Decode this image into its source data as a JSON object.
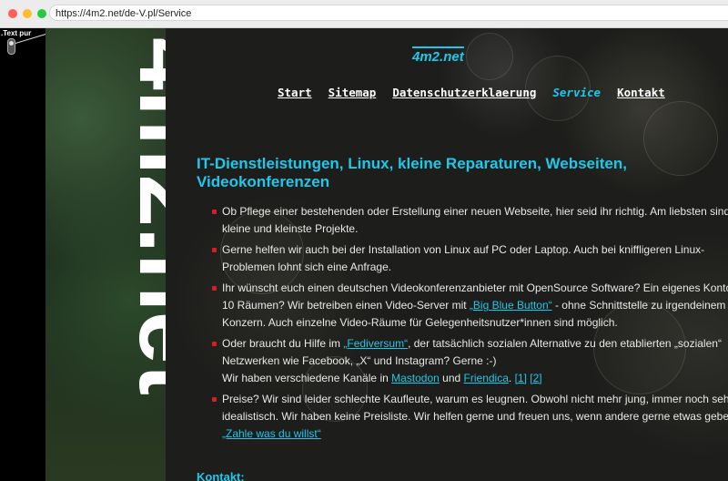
{
  "browser": {
    "url": "https://4m2.net/de-V.pl/Service"
  },
  "toggle": {
    "label": ".Text pur"
  },
  "sidebar": {
    "vertical_logo": "4m2.net"
  },
  "header": {
    "logo": "4m2.net"
  },
  "nav": {
    "items": [
      {
        "label": "Start"
      },
      {
        "label": "Sitemap"
      },
      {
        "label": "Datenschutzerklaerung"
      },
      {
        "label": "Service",
        "active": true
      },
      {
        "label": "Kontakt"
      }
    ]
  },
  "main": {
    "heading_line1": "IT-Dienstleistungen, Linux, kleine Reparaturen, Webseiten,",
    "heading_line2": "Videokonferenzen",
    "items": [
      {
        "l1": "Ob Pflege einer bestehenden oder Erstellung einer neuen Webseite, hier seid ihr richtig. Am liebsten sind u",
        "l2": "kleine und kleinste Projekte."
      },
      {
        "l1": "Gerne helfen wir auch bei der Installation von Linux auf PC oder Laptop. Auch bei kniffligeren Linux-",
        "l2": "Problemen lohnt sich eine Anfrage."
      },
      {
        "l1": "Ihr wünscht euch einen deutschen Videokonferenzanbieter mit OpenSource Software? Ein eigenes Konto m",
        "l2_pre": "10 Räumen? Wir betreiben einen Video-Server mit ",
        "l2_link": "„Big Blue Button“",
        "l2_post": " - ohne Schnittstelle zu irgendeinem US",
        "l3": "Konzern. Auch einzelne Video-Räume für Gelegenheitsnutzer*innen sind möglich."
      },
      {
        "l1_pre": "Oder braucht du Hilfe im ",
        "l1_link": "„Fediversum“",
        "l1_post": ", der tatsächlich sozialen Alternative zu den etablierten „sozialen“",
        "l2": "Netzwerken wie Facebook, „X“ und Instagram? Gerne :-)",
        "l3_pre": "Wir haben verschiedene Kanäle in ",
        "l3_link1": "Mastodon",
        "l3_mid": " und ",
        "l3_link2": "Friendica",
        "l3_sep": ". ",
        "l3_ref1": "[1]",
        "l3_ref2": "[2]"
      },
      {
        "l1": "Preise? Wir sind leider schlechte Kaufleute, warum es leugnen. Obwohl nicht mehr jung, immer noch sehr",
        "l2": "idealistisch. Wir haben keine Preisliste. Wir helfen gerne und freuen uns, wenn andere gerne etwas geben.",
        "l3_link": "„Zahle was du willst“"
      }
    ],
    "contact_heading": "Kontakt:"
  },
  "colors": {
    "accent": "#1ec8ea",
    "bullet": "#d42020",
    "text": "#e8e8e8"
  }
}
